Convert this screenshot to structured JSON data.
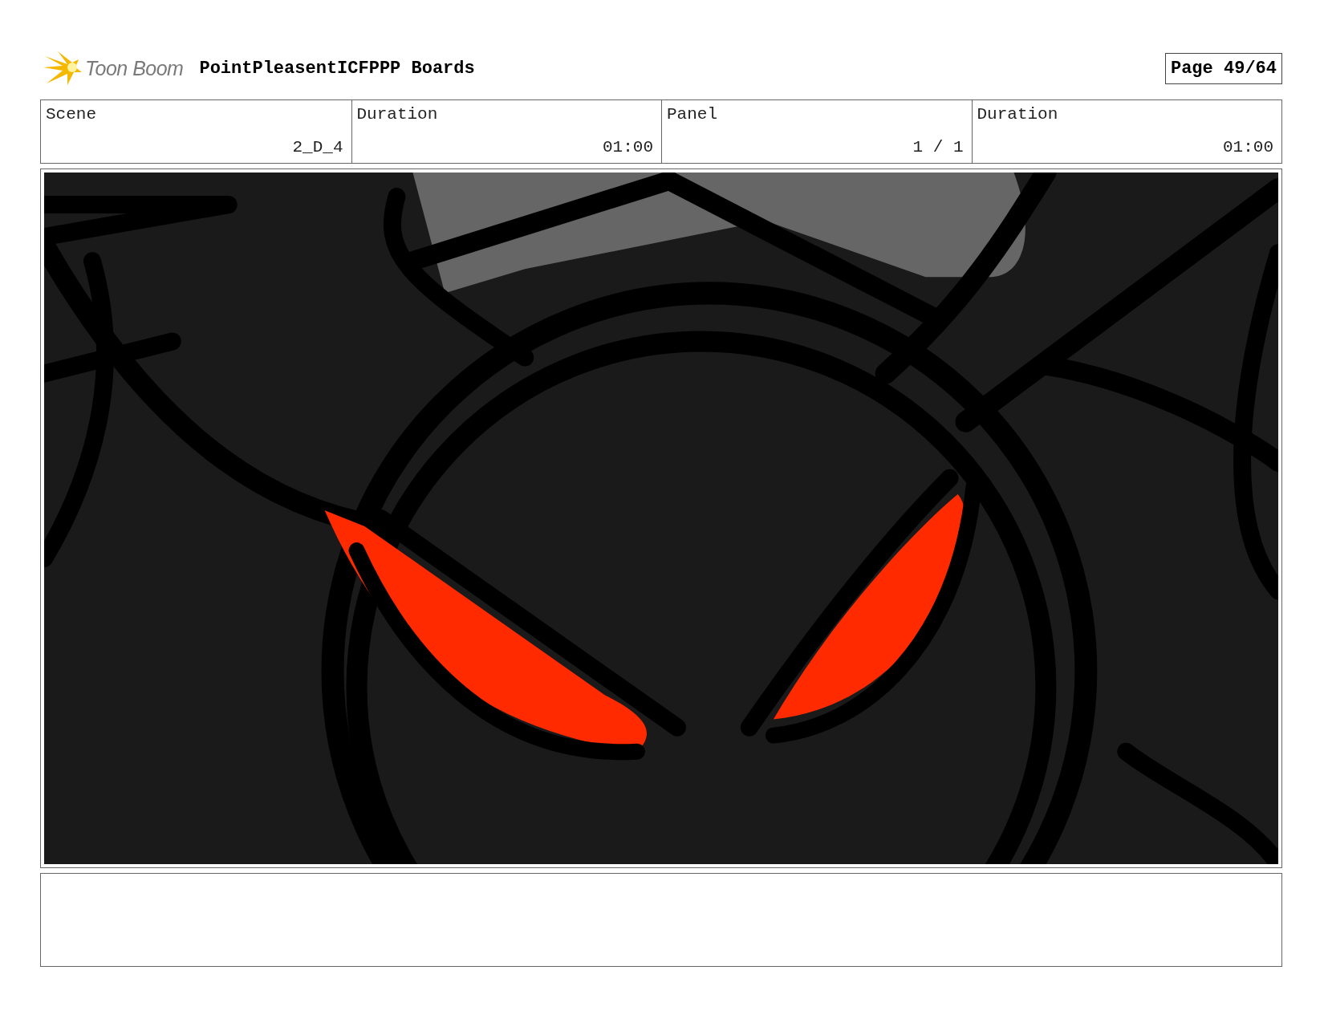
{
  "header": {
    "logo_text": "Toon Boom",
    "title": "PointPleasentICFPPP Boards",
    "page": "Page 49/64"
  },
  "info_table": {
    "columns": [
      "Scene",
      "Duration",
      "Panel",
      "Duration"
    ],
    "rows": [
      [
        "2_D_4",
        "01:00",
        "1 / 1",
        "01:00"
      ]
    ]
  }
}
